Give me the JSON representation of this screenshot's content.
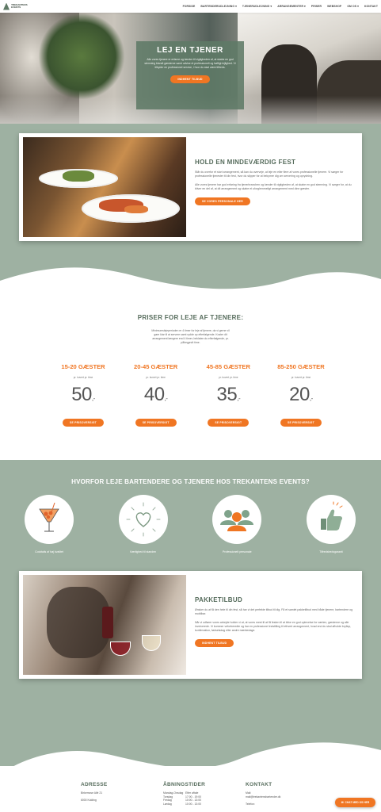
{
  "nav": {
    "logo_text": "TREKANTENS EVENTS",
    "items": [
      "FORSIDE",
      "BARTENDERUDLEJNING ▾",
      "TJENERUDLEJNING ▾",
      "ARRANGEMENTER ▾",
      "PRISER",
      "WEBSHOP",
      "OM OS ▾",
      "KONTAKT"
    ]
  },
  "hero": {
    "title": "LEJ EN TJENER",
    "text": "Alle vores tjenere er erfarne og kender til vigtigheden af, at skabe en god stemning blandt gæsterne samt udvise et professionelt og høfligt lejlighed. Vi tilbyder en professionel service, i hvor du skal være tilfreds.",
    "button": "INDHENT TILBUD"
  },
  "fest": {
    "title": "HOLD EN MINDEVÆRDIG FEST",
    "p1": "Står du overfor et stort arrangement, så kan du overveje, at leje en eller flere af vores professionelle tjenere. Vi sørger for professionelle tjenester til din fest, hvor du slipper for at bekymre dig om servering og oprydning.",
    "p2": "Alle vores tjenere har god erfaring fra tjenerbranchen og kender til vigtigheden af, at skabe en god stemning. Vi sørger for, at du bliver en del af, at dit arrangement og skabe et uforglemmeligt arrangement med dine gæster.",
    "button": "SE VORES PERSONALE HER"
  },
  "prices": {
    "title": "PRISER FOR LEJE AF TJENERE:",
    "intro": "Minimumslejeperioden er 4 timer for leje af tjenere, da vi gerne vil gøre klar til at servere samt rydde op efterfølgende. Koster dit arrangement længere end 4 timer, beklaten du efterfølgende, pr. påbegyndt time.",
    "tiers": [
      {
        "head": "15-20 GÆSTER",
        "sub": "pr. kuvert pr. time",
        "value": "50",
        "suffix": ",-",
        "button": "SE PRISOVERSIGT"
      },
      {
        "head": "20-45 GÆSTER",
        "sub": "pr. kuvert pr. time",
        "value": "40",
        "suffix": ",-",
        "button": "SE PRISOVERSIGT"
      },
      {
        "head": "45-85 GÆSTER",
        "sub": "pr. kuvert pr. time",
        "value": "35",
        "suffix": ",-",
        "button": "SE PRISOVERSIGT"
      },
      {
        "head": "85-250 GÆSTER",
        "sub": "pr. kuvert pr. time",
        "value": "20",
        "suffix": ",-",
        "button": "SE PRISOVERSIGT"
      }
    ]
  },
  "why": {
    "title": "HVORFOR LEJE BARTENDERE OG TJENERE HOS TREKANTENS EVENTS?",
    "features": [
      {
        "label": "Cocktails af høj kvalitet",
        "icon": "cocktail-icon"
      },
      {
        "label": "Kærlighed til standen",
        "icon": "heart-icon"
      },
      {
        "label": "Professionelt personale",
        "icon": "people-icon"
      },
      {
        "label": "Tilfredshedsgaranti",
        "icon": "thumbs-up-icon"
      }
    ]
  },
  "package": {
    "title": "PAKKETILBUD",
    "p1": "Ønsker du at få den hele til din fest, så har vi det perfekte tilbud til dig. Få et samlet pakketilbud med både tjenere, bartendere og mobilbar.",
    "p2": "Når vi udfører vores arbejde holder vi at, at vores mest til at få festen til at blive en god oplevelse for værten, gæsterne og alle involverede. Vi kommer veforberedte og har en professionel indstilling til ethvert arrangement, hvad end du skal afholde bryllup, konfirmation, fødselsdag eller andre mærkedage.",
    "button": "INDHENT TILBUD"
  },
  "footer": {
    "address_head": "ADRESSE",
    "address_lines": [
      "Birkemose Allé 21",
      "6000 Kolding"
    ],
    "hours_head": "ÅBNINGSTIDER",
    "hours": [
      [
        "Mandag-Onsdag",
        "Efter aftale"
      ],
      [
        "Torsdag",
        "17:00 - 19:00"
      ],
      [
        "Fredag",
        "10:00 - 13:00"
      ],
      [
        "Lørdag",
        "10:00 - 13:00"
      ]
    ],
    "contact_head": "KONTAKT",
    "contact_lines": [
      "Mail:",
      "mail@trekantensbartender.dk",
      "Telefon:"
    ]
  },
  "chat": {
    "label": "CHAT MED OS HER"
  },
  "colors": {
    "accent": "#f07623",
    "green": "#9eb1a2",
    "heading": "#556b5b"
  }
}
